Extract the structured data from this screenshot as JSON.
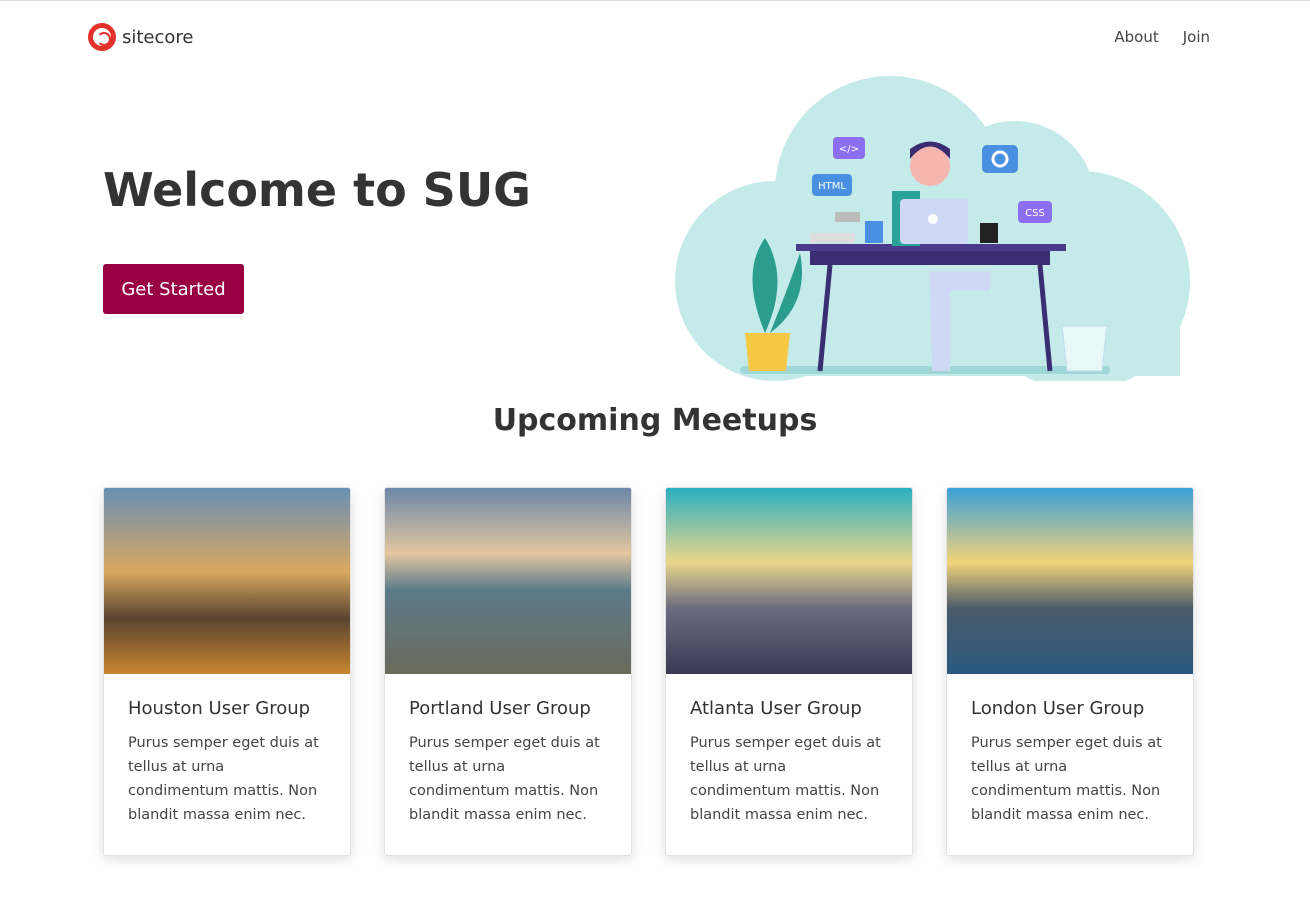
{
  "nav": {
    "brand": "sitecore",
    "links": [
      "About",
      "Join"
    ]
  },
  "hero": {
    "title": "Welcome to SUG",
    "button": "Get Started",
    "illustration_labels": [
      "</>",
      "HTML",
      "CSS"
    ]
  },
  "section_title": "Upcoming Meetups",
  "cards": [
    {
      "title": "Houston User Group",
      "text": "Purus semper eget duis at tellus at urna condimentum mattis. Non blandit massa enim nec."
    },
    {
      "title": "Portland User Group",
      "text": "Purus semper eget duis at tellus at urna condimentum mattis. Non blandit massa enim nec."
    },
    {
      "title": "Atlanta User Group",
      "text": "Purus semper eget duis at tellus at urna condimentum mattis. Non blandit massa enim nec."
    },
    {
      "title": "London User Group",
      "text": "Purus semper eget duis at tellus at urna condimentum mattis. Non blandit massa enim nec."
    }
  ]
}
